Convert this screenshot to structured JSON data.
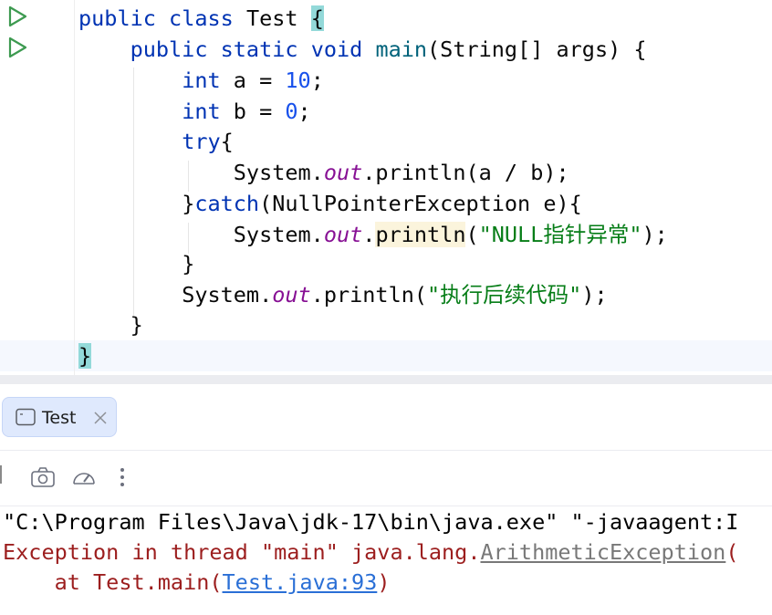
{
  "editor": {
    "line1": {
      "kw1": "public",
      "kw2": "class",
      "name": "Test",
      "brace": "{"
    },
    "line2": {
      "kw1": "public",
      "kw2": "static",
      "kw3": "void",
      "method": "main",
      "params": "(String[] args) {"
    },
    "line3": {
      "kw": "int",
      "rest": "a = ",
      "num": "10",
      "end": ";"
    },
    "line4": {
      "kw": "int",
      "rest": "b = ",
      "num": "0",
      "end": ";"
    },
    "line5": {
      "kw": "try",
      "rest": "{"
    },
    "line6": {
      "pre": "System.",
      "field": "out",
      "mid": ".println(a / b);"
    },
    "line7": {
      "pre": "}",
      "kw": "catch",
      "rest": "(NullPointerException e){"
    },
    "line8": {
      "pre": "System.",
      "field": "out",
      "dot": ".",
      "method": "println",
      "open": "(",
      "str": "\"NULL指针异常\"",
      "end": ");"
    },
    "line9": {
      "text": "}"
    },
    "line10": {
      "pre": "System.",
      "field": "out",
      "mid": ".println(",
      "str": "\"执行后续代码\"",
      "end": ");"
    },
    "line11": {
      "text": "}"
    },
    "line12": {
      "text": "}"
    }
  },
  "run_window": {
    "tab_label": "Test"
  },
  "console": {
    "line1": "\"C:\\Program Files\\Java\\jdk-17\\bin\\java.exe\" \"-javaagent:I",
    "line2_prefix": "Exception in thread \"main\" java.lang.",
    "line2_link": "ArithmeticException",
    "line2_suffix": "(",
    "line3_prefix": "    at Test.main(",
    "line3_link": "Test.java:93",
    "line3_suffix": ")"
  },
  "colors": {
    "keyword": "#0033b3",
    "number": "#1750eb",
    "field": "#871094",
    "string": "#067d17",
    "error": "#9c1e1e",
    "link": "#2a6fd6",
    "run_icon": "#3d9a50"
  }
}
